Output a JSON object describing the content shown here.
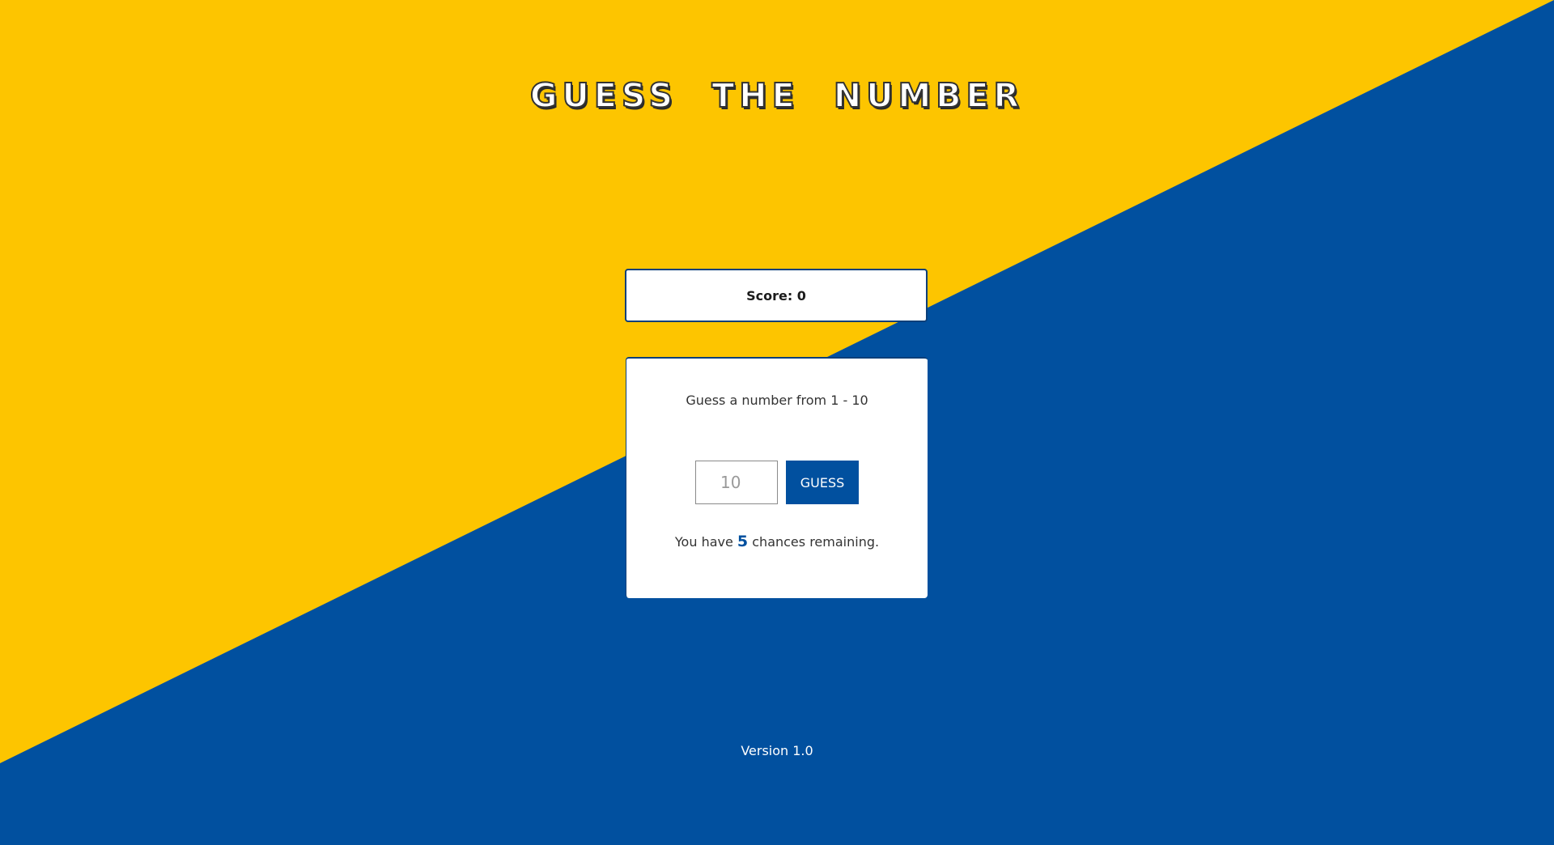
{
  "app": {
    "title": "GUESS THE NUMBER"
  },
  "colors": {
    "yellow": "#FDC500",
    "blue": "#01509F",
    "white": "#FFFFFF"
  },
  "score": {
    "label": "Score: 0"
  },
  "game": {
    "instructions": "Guess a number from 1 - 10",
    "input": {
      "value": "",
      "placeholder": "10"
    },
    "guess_button_label": "GUESS",
    "chances_prefix": "You have",
    "chances_count": "5",
    "chances_suffix": "chances remaining."
  },
  "footer": {
    "version": "Version 1.0"
  }
}
